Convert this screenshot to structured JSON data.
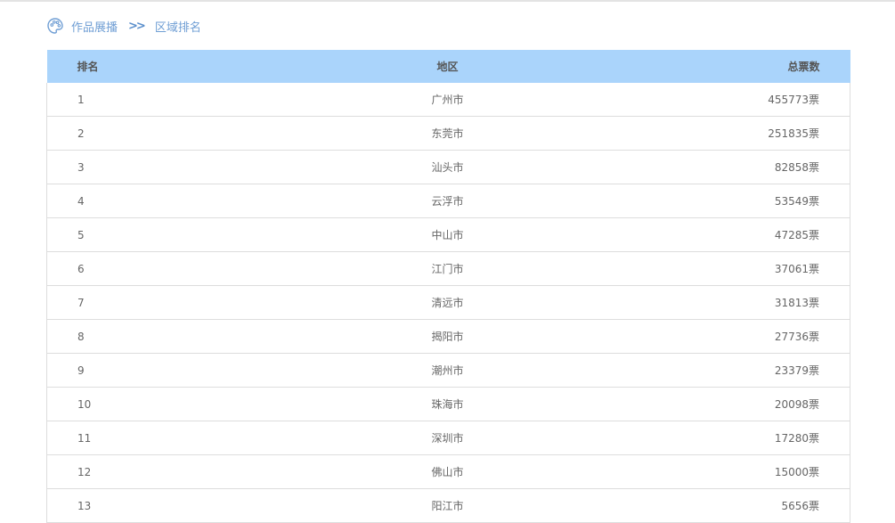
{
  "breadcrumb": {
    "icon": "palette-icon",
    "home_label": "作品展播",
    "separator": ">>",
    "current_label": "区域排名"
  },
  "table": {
    "headers": {
      "rank": "排名",
      "region": "地区",
      "votes": "总票数"
    },
    "rows": [
      {
        "rank": "1",
        "region": "广州市",
        "votes": "455773票"
      },
      {
        "rank": "2",
        "region": "东莞市",
        "votes": "251835票"
      },
      {
        "rank": "3",
        "region": "汕头市",
        "votes": "82858票"
      },
      {
        "rank": "4",
        "region": "云浮市",
        "votes": "53549票"
      },
      {
        "rank": "5",
        "region": "中山市",
        "votes": "47285票"
      },
      {
        "rank": "6",
        "region": "江门市",
        "votes": "37061票"
      },
      {
        "rank": "7",
        "region": "清远市",
        "votes": "31813票"
      },
      {
        "rank": "8",
        "region": "揭阳市",
        "votes": "27736票"
      },
      {
        "rank": "9",
        "region": "潮州市",
        "votes": "23379票"
      },
      {
        "rank": "10",
        "region": "珠海市",
        "votes": "20098票"
      },
      {
        "rank": "11",
        "region": "深圳市",
        "votes": "17280票"
      },
      {
        "rank": "12",
        "region": "佛山市",
        "votes": "15000票"
      },
      {
        "rank": "13",
        "region": "阳江市",
        "votes": "5656票"
      }
    ]
  },
  "colors": {
    "header_background": "#aad4fb",
    "breadcrumb_link": "#6f9ed4"
  }
}
